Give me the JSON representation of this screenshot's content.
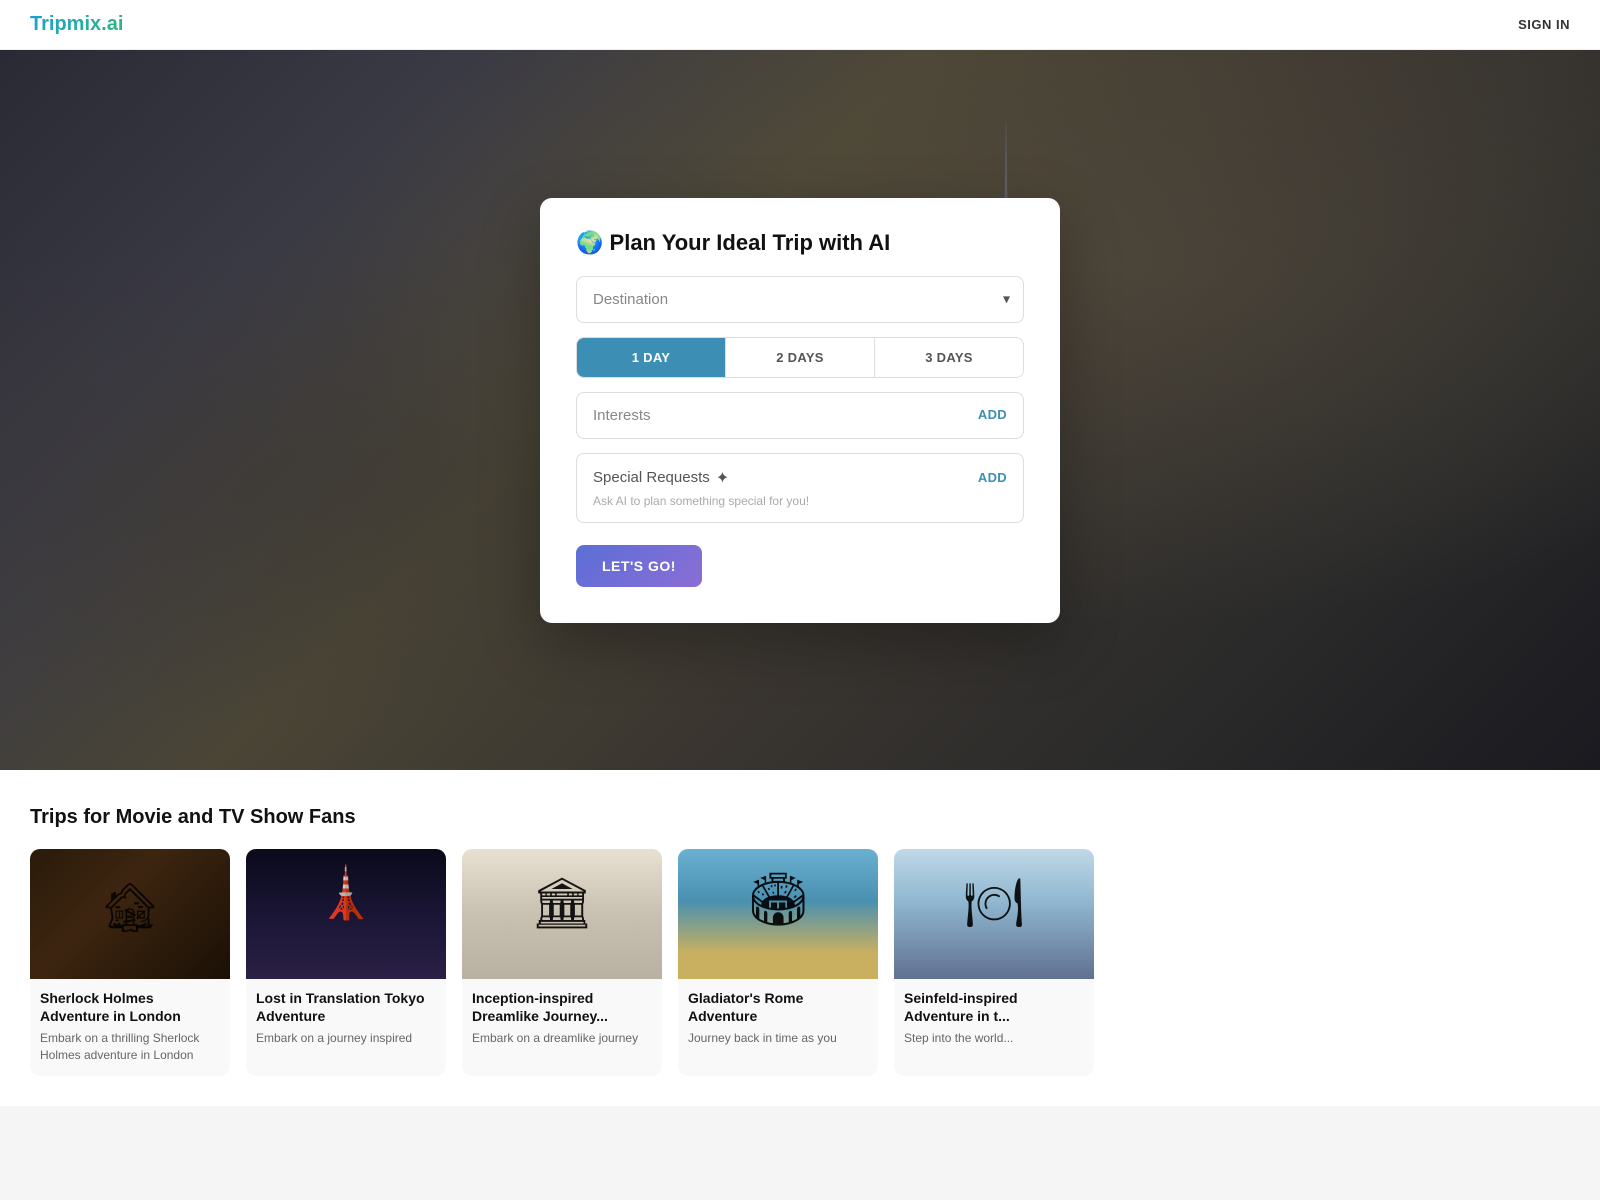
{
  "header": {
    "logo": "Tripmix.ai",
    "sign_in": "SIGN IN"
  },
  "hero": {
    "modal": {
      "title_icon": "🌍",
      "title": "Plan Your Ideal Trip with AI",
      "destination_placeholder": "Destination",
      "day_tabs": [
        {
          "label": "1 DAY",
          "active": true
        },
        {
          "label": "2 DAYS",
          "active": false
        },
        {
          "label": "3 DAYS",
          "active": false
        }
      ],
      "interests_label": "Interests",
      "interests_add": "ADD",
      "special_requests_label": "Special Requests",
      "special_requests_icon": "✦",
      "special_requests_sub": "Ask AI to plan something special for you!",
      "special_requests_add": "ADD",
      "cta_label": "LET'S GO!"
    }
  },
  "bottom": {
    "section_title": "Trips for Movie and TV Show Fans",
    "cards": [
      {
        "id": "sherlock",
        "title": "Sherlock Holmes Adventure in London",
        "desc": "Embark on a thrilling Sherlock Holmes adventure in London",
        "img_class": "card-img-sherlock"
      },
      {
        "id": "tokyo",
        "title": "Lost in Translation Tokyo Adventure",
        "desc": "Embark on a journey inspired",
        "img_class": "card-img-tokyo"
      },
      {
        "id": "inception",
        "title": "Inception-inspired Dreamlike Journey...",
        "desc": "Embark on a dreamlike journey",
        "img_class": "card-img-inception"
      },
      {
        "id": "rome",
        "title": "Gladiator's Rome Adventure",
        "desc": "Journey back in time as you",
        "img_class": "card-img-rome"
      },
      {
        "id": "seinfeld",
        "title": "Seinfeld-inspired Adventure in t...",
        "desc": "Step into the world...",
        "img_class": "card-img-seinfeld"
      }
    ]
  }
}
